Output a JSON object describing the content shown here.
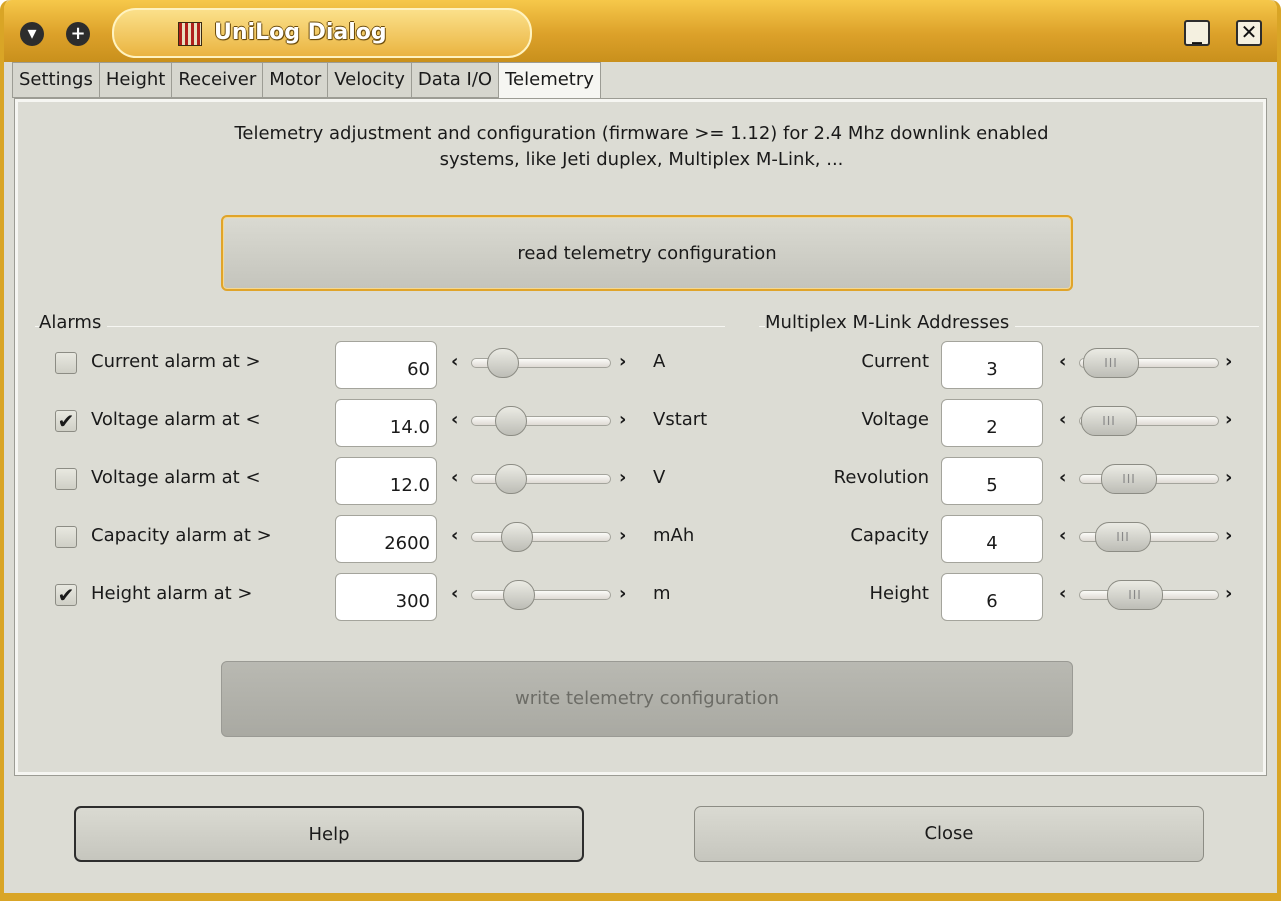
{
  "window": {
    "title": "UniLog Dialog",
    "menu_icon": "chevron-down-icon",
    "pin_icon": "plus-icon",
    "minimize_icon": "minimize-icon",
    "close_glyph": "✕"
  },
  "tabs": [
    "Settings",
    "Height",
    "Receiver",
    "Motor",
    "Velocity",
    "Data I/O",
    "Telemetry"
  ],
  "active_tab": "Telemetry",
  "description": "Telemetry adjustment and configuration (firmware >= 1.12) for 2.4 Mhz downlink enabled\nsystems, like Jeti duplex, Multiplex M-Link, ...",
  "read_button": "read telemetry configuration",
  "write_button": "write telemetry configuration",
  "alarms": {
    "group_label": "Alarms",
    "rows": [
      {
        "label": "Current alarm at >",
        "checked": false,
        "value": "60",
        "unit": "A"
      },
      {
        "label": "Voltage alarm at <",
        "checked": true,
        "value": "14.0",
        "unit": "Vstart"
      },
      {
        "label": "Voltage alarm at <",
        "checked": false,
        "value": "12.0",
        "unit": "V"
      },
      {
        "label": "Capacity alarm at >",
        "checked": false,
        "value": "2600",
        "unit": "mAh"
      },
      {
        "label": "Height alarm at >",
        "checked": true,
        "value": "300",
        "unit": "m"
      }
    ]
  },
  "mlink": {
    "group_label": "Multiplex M-Link Addresses",
    "rows": [
      {
        "label": "Current",
        "value": "3"
      },
      {
        "label": "Voltage",
        "value": "2"
      },
      {
        "label": "Revolution",
        "value": "5"
      },
      {
        "label": "Capacity",
        "value": "4"
      },
      {
        "label": "Height",
        "value": "6"
      }
    ]
  },
  "arrows": {
    "left": "‹",
    "right": "›"
  },
  "checkmark": "✔",
  "thumb_grip": "III",
  "footer": {
    "help": "Help",
    "close": "Close"
  },
  "colors": {
    "accent": "#d9a526",
    "panel": "#dcdcd4"
  }
}
